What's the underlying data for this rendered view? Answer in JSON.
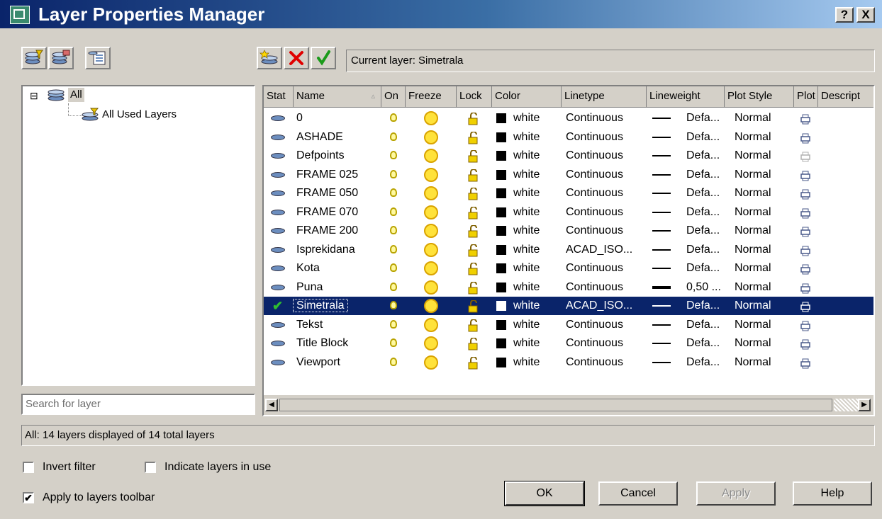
{
  "window": {
    "title": "Layer Properties Manager",
    "help_button": "?",
    "close_button": "X"
  },
  "toolbar": {
    "new_property_filter_icon": "layers-filter-icon",
    "new_group_filter_icon": "layers-group-icon",
    "layer_states_icon": "layer-states-icon",
    "new_layer_icon": "new-layer-icon",
    "delete_layer_icon": "delete-icon",
    "set_current_icon": "checkmark-icon",
    "current_layer_label": "Current layer: Simetrala"
  },
  "tree": {
    "root_expander": "⊟",
    "root_label": "All",
    "child_label": "All Used Layers"
  },
  "search": {
    "placeholder": "Search for layer",
    "value": ""
  },
  "table": {
    "columns": [
      "Stat",
      "Name",
      "On",
      "Freeze",
      "Lock",
      "Color",
      "Linetype",
      "Lineweight",
      "Plot Style",
      "Plot",
      "Descript"
    ],
    "sort_indicator": "▵",
    "rows": [
      {
        "name": "0",
        "color": "white",
        "linetype": "Continuous",
        "lineweight": "Defa...",
        "plot_style": "Normal",
        "current": false,
        "plot_disabled": false,
        "bold_line": false
      },
      {
        "name": "ASHADE",
        "color": "white",
        "linetype": "Continuous",
        "lineweight": "Defa...",
        "plot_style": "Normal",
        "current": false,
        "plot_disabled": false,
        "bold_line": false
      },
      {
        "name": "Defpoints",
        "color": "white",
        "linetype": "Continuous",
        "lineweight": "Defa...",
        "plot_style": "Normal",
        "current": false,
        "plot_disabled": true,
        "bold_line": false
      },
      {
        "name": "FRAME 025",
        "color": "white",
        "linetype": "Continuous",
        "lineweight": "Defa...",
        "plot_style": "Normal",
        "current": false,
        "plot_disabled": false,
        "bold_line": false
      },
      {
        "name": "FRAME 050",
        "color": "white",
        "linetype": "Continuous",
        "lineweight": "Defa...",
        "plot_style": "Normal",
        "current": false,
        "plot_disabled": false,
        "bold_line": false
      },
      {
        "name": "FRAME 070",
        "color": "white",
        "linetype": "Continuous",
        "lineweight": "Defa...",
        "plot_style": "Normal",
        "current": false,
        "plot_disabled": false,
        "bold_line": false
      },
      {
        "name": "FRAME 200",
        "color": "white",
        "linetype": "Continuous",
        "lineweight": "Defa...",
        "plot_style": "Normal",
        "current": false,
        "plot_disabled": false,
        "bold_line": false
      },
      {
        "name": "Isprekidana",
        "color": "white",
        "linetype": "ACAD_ISO...",
        "lineweight": "Defa...",
        "plot_style": "Normal",
        "current": false,
        "plot_disabled": false,
        "bold_line": false
      },
      {
        "name": "Kota",
        "color": "white",
        "linetype": "Continuous",
        "lineweight": "Defa...",
        "plot_style": "Normal",
        "current": false,
        "plot_disabled": false,
        "bold_line": false
      },
      {
        "name": "Puna",
        "color": "white",
        "linetype": "Continuous",
        "lineweight": "0,50 ...",
        "plot_style": "Normal",
        "current": false,
        "plot_disabled": false,
        "bold_line": true
      },
      {
        "name": "Simetrala",
        "color": "white",
        "linetype": "ACAD_ISO...",
        "lineweight": "Defa...",
        "plot_style": "Normal",
        "current": true,
        "plot_disabled": false,
        "bold_line": false
      },
      {
        "name": "Tekst",
        "color": "white",
        "linetype": "Continuous",
        "lineweight": "Defa...",
        "plot_style": "Normal",
        "current": false,
        "plot_disabled": false,
        "bold_line": false
      },
      {
        "name": "Title Block",
        "color": "white",
        "linetype": "Continuous",
        "lineweight": "Defa...",
        "plot_style": "Normal",
        "current": false,
        "plot_disabled": false,
        "bold_line": false
      },
      {
        "name": "Viewport",
        "color": "white",
        "linetype": "Continuous",
        "lineweight": "Defa...",
        "plot_style": "Normal",
        "current": false,
        "plot_disabled": false,
        "bold_line": false
      }
    ]
  },
  "status": {
    "text": "All: 14 layers displayed of 14 total layers"
  },
  "options": {
    "invert_filter": {
      "label": "Invert filter",
      "checked": false
    },
    "indicate_in_use": {
      "label": "Indicate layers in use",
      "checked": false
    },
    "apply_to_toolbar": {
      "label": "Apply to layers toolbar",
      "checked": true
    }
  },
  "buttons": {
    "ok": "OK",
    "cancel": "Cancel",
    "apply": "Apply",
    "help": "Help"
  },
  "colors": {
    "title_start": "#0a246a",
    "title_end": "#a6caf0",
    "selection": "#0a246a",
    "dialog_face": "#d4d0c8"
  }
}
